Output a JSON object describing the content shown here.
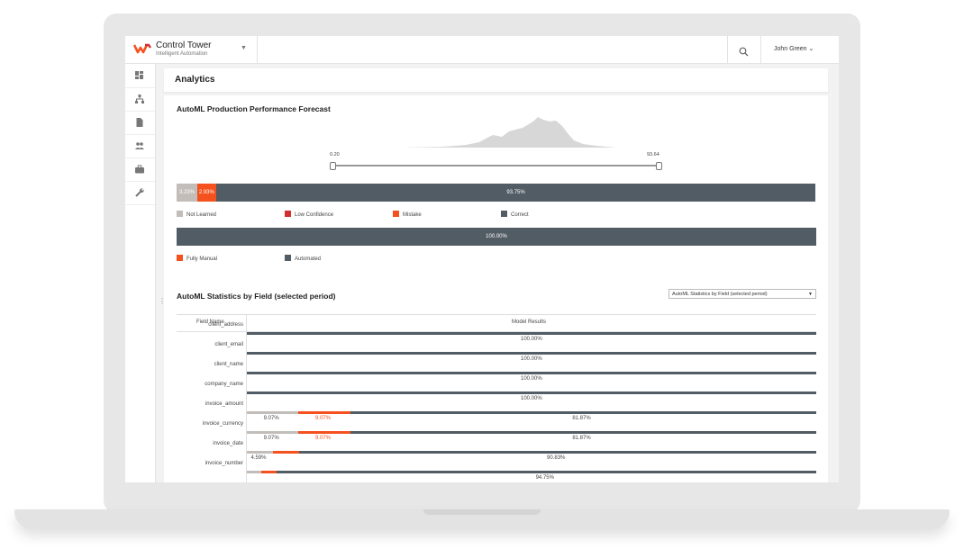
{
  "app": {
    "title": "Control Tower",
    "subtitle": "Intelligent Automation"
  },
  "user": {
    "name": "John Green ⌄"
  },
  "page": {
    "title": "Analytics"
  },
  "forecast": {
    "title": "AutoML Production Performance Forecast",
    "range_min": "0.20",
    "range_max": "93.64",
    "performance_bar": [
      {
        "label": "3.23%",
        "value": 3.23,
        "color": "#c2bdb9"
      },
      {
        "label": "2.93%",
        "value": 2.93,
        "color": "#f4511e"
      },
      {
        "label": "93.75%",
        "value": 93.75,
        "color": "#525c65"
      }
    ],
    "performance_legend": [
      {
        "label": "Not Learned",
        "color": "#c2bdb9"
      },
      {
        "label": "Low Confidence",
        "color": "#d32f2f"
      },
      {
        "label": "Mistake",
        "color": "#f4511e"
      },
      {
        "label": "Correct",
        "color": "#525c65"
      }
    ],
    "automation_bar": [
      {
        "label": "100.00%",
        "value": 100,
        "color": "#525c65"
      }
    ],
    "automation_legend": [
      {
        "label": "Fully Manual",
        "color": "#f4511e"
      },
      {
        "label": "Automated",
        "color": "#525c65"
      }
    ]
  },
  "stats": {
    "title": "AutoML Statistics by Field (selected period)",
    "select_value": "AutoML Statistics by Field (selected period)",
    "col_field": "Field Name",
    "col_results": "Model Results",
    "rows": [
      {
        "field": "client_address",
        "grey": 0,
        "orange": 0,
        "dark": 100,
        "grey_label": "",
        "orange_label": "",
        "dark_label": "100.00%"
      },
      {
        "field": "client_email",
        "grey": 0,
        "orange": 0,
        "dark": 100,
        "grey_label": "",
        "orange_label": "",
        "dark_label": "100.00%"
      },
      {
        "field": "client_name",
        "grey": 0,
        "orange": 0,
        "dark": 100,
        "grey_label": "",
        "orange_label": "",
        "dark_label": "100.00%"
      },
      {
        "field": "company_name",
        "grey": 0,
        "orange": 0,
        "dark": 100,
        "grey_label": "",
        "orange_label": "",
        "dark_label": "100.00%"
      },
      {
        "field": "invoice_amount",
        "grey": 9.07,
        "orange": 9.07,
        "dark": 81.87,
        "grey_label": "9.07%",
        "orange_label": "9.07%",
        "dark_label": "81.87%"
      },
      {
        "field": "invoice_currency",
        "grey": 9.07,
        "orange": 9.07,
        "dark": 81.87,
        "grey_label": "9.07%",
        "orange_label": "9.07%",
        "dark_label": "81.87%"
      },
      {
        "field": "invoice_date",
        "grey": 4.59,
        "orange": 4.59,
        "dark": 90.83,
        "grey_label": "4.59%",
        "orange_label": "",
        "dark_label": "90.83%"
      },
      {
        "field": "invoice_number",
        "grey": 2.5,
        "orange": 2.75,
        "dark": 94.75,
        "grey_label": "",
        "orange_label": "",
        "dark_label": "94.75%"
      }
    ]
  },
  "colors": {
    "accent": "#f4511e",
    "dark": "#525c65",
    "light": "#c2bdb9",
    "red": "#d32f2f"
  }
}
